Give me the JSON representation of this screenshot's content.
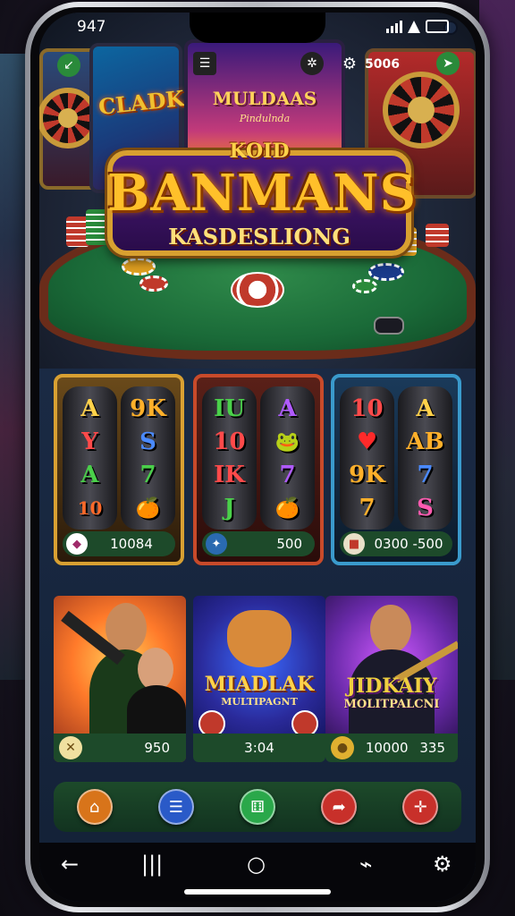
{
  "status": {
    "time": "947"
  },
  "header": {
    "left_machine_label": "CLADK",
    "center_machine_title": "MULDAAS",
    "center_machine_sub": "Pindulnda",
    "coins": "5006"
  },
  "banner": {
    "small": "KOID",
    "title": "BANMANS",
    "subtitle": "KASDESLIONG"
  },
  "slots": [
    {
      "theme": "gold",
      "reels": [
        [
          "A",
          "Y",
          "A",
          "10"
        ],
        [
          "9K",
          "S",
          "7",
          "🍊"
        ]
      ],
      "value": "10084",
      "badge_icon": "player-icon"
    },
    {
      "theme": "red",
      "reels": [
        [
          "IU",
          "10",
          "IK",
          "J"
        ],
        [
          "A",
          "🐸",
          "7",
          "🍊"
        ]
      ],
      "value": "500",
      "badge_icon": "star-icon"
    },
    {
      "theme": "blue",
      "reels": [
        [
          "10",
          "♥",
          "9K",
          "7"
        ],
        [
          "A",
          "AB",
          "7",
          "S"
        ]
      ],
      "value": "0300 -500",
      "badge_icon": "gift-icon"
    }
  ],
  "cards": [
    {
      "title": "",
      "value": "950",
      "badge_icon": "coin-icon"
    },
    {
      "title": "MIADLAK",
      "subtitle": "MULTIPAGNT",
      "value": "3:04",
      "badge_icon": "chip-icon"
    },
    {
      "title": "JIDKAIY",
      "subtitle": "MOLITPALCNI",
      "value": "10000",
      "value2": "335",
      "badge_icon": "coin-icon"
    }
  ],
  "nav": [
    "home-icon",
    "menu-icon",
    "dice-icon",
    "share-icon",
    "target-icon"
  ],
  "colors": {
    "accent_gold": "#d8a032",
    "felt_green": "#1a6a38",
    "panel_bg": "#1a2a44",
    "bar_green": "#1d4a2a"
  }
}
